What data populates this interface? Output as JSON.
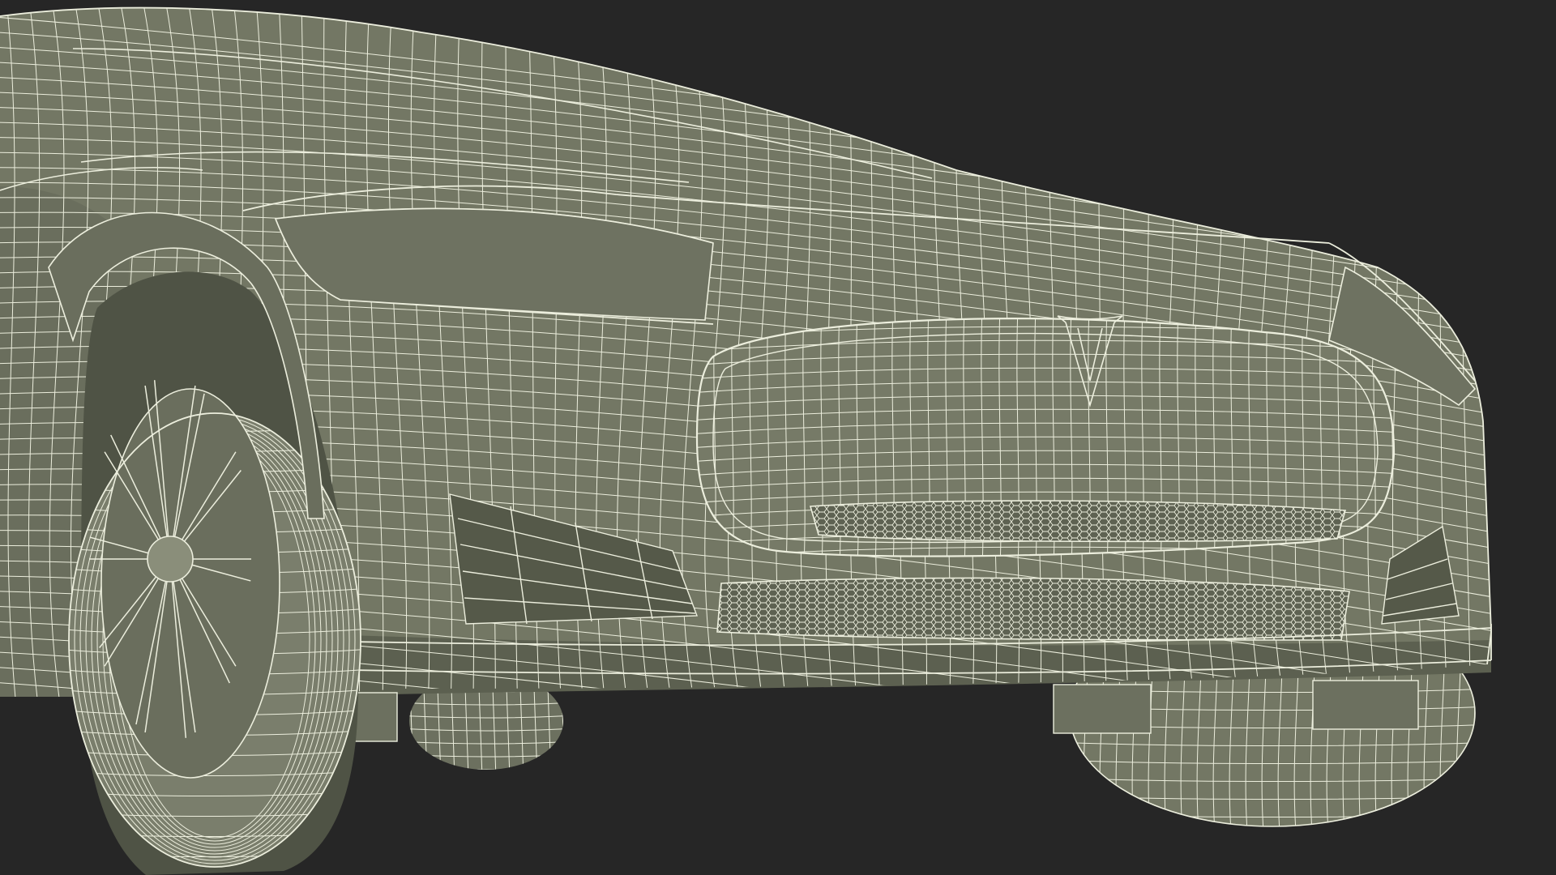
{
  "scene": {
    "subject": "3d-wireframe-car-front",
    "colors": {
      "background": "#262626",
      "surface": "#737764",
      "surface_dark": "#5e6252",
      "surface_shadow": "#4a4d41",
      "wire": "#eceedd",
      "tire": "#7a7e6c",
      "rim": "#8a8e7a"
    }
  }
}
